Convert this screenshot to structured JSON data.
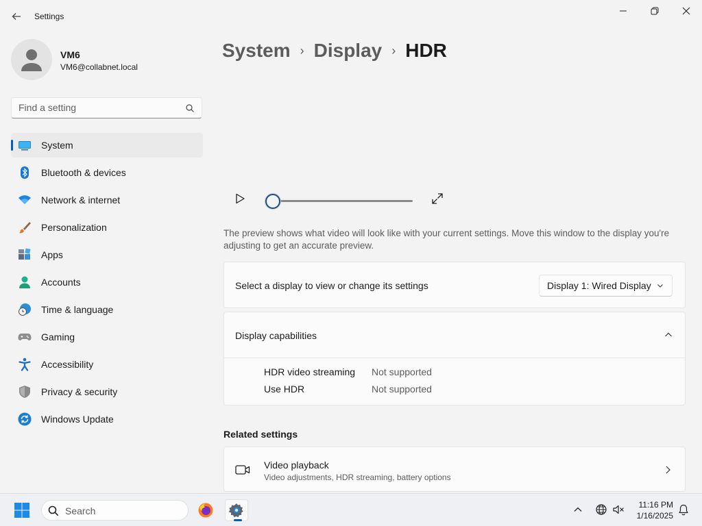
{
  "window": {
    "title": "Settings"
  },
  "user": {
    "name": "VM6",
    "email": "VM6@collabnet.local"
  },
  "search": {
    "placeholder": "Find a setting"
  },
  "nav": {
    "items": [
      {
        "label": "System",
        "icon": "system-icon",
        "selected": true
      },
      {
        "label": "Bluetooth & devices",
        "icon": "bluetooth-icon"
      },
      {
        "label": "Network & internet",
        "icon": "wifi-icon"
      },
      {
        "label": "Personalization",
        "icon": "brush-icon"
      },
      {
        "label": "Apps",
        "icon": "apps-icon"
      },
      {
        "label": "Accounts",
        "icon": "accounts-icon"
      },
      {
        "label": "Time & language",
        "icon": "clock-globe-icon"
      },
      {
        "label": "Gaming",
        "icon": "gamepad-icon"
      },
      {
        "label": "Accessibility",
        "icon": "accessibility-icon"
      },
      {
        "label": "Privacy & security",
        "icon": "shield-icon"
      },
      {
        "label": "Windows Update",
        "icon": "update-icon"
      }
    ]
  },
  "breadcrumb": {
    "item1": "System",
    "item2": "Display",
    "current": "HDR",
    "separator": "›"
  },
  "player": {
    "progress": 0
  },
  "preview": {
    "text": "The preview shows what video will look like with your current settings. Move this window to the display you're adjusting to get an accurate preview."
  },
  "display_select": {
    "label": "Select a display to view or change its settings",
    "value": "Display 1: Wired Display"
  },
  "capabilities": {
    "title": "Display capabilities",
    "rows": [
      {
        "name": "HDR video streaming",
        "value": "Not supported"
      },
      {
        "name": "Use HDR",
        "value": "Not supported"
      }
    ]
  },
  "related": {
    "title": "Related settings",
    "video_playback": {
      "title": "Video playback",
      "subtitle": "Video adjustments, HDR streaming, battery options"
    }
  },
  "taskbar": {
    "search_label": "Search",
    "time": "11:16 PM",
    "date": "1/16/2025"
  },
  "colors": {
    "accent": "#005fb8",
    "background": "#f3f3f3",
    "card": "#fbfbfb"
  }
}
